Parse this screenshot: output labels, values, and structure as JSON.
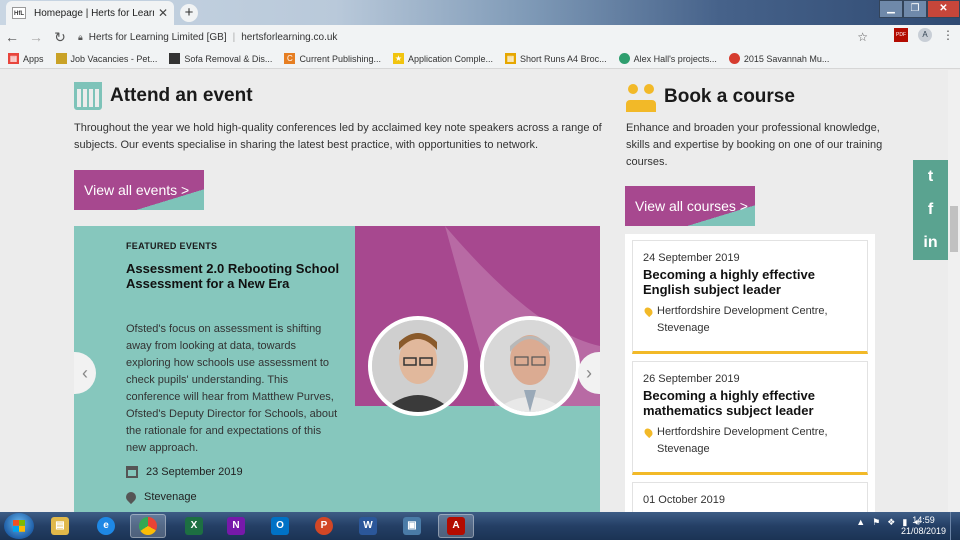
{
  "browser": {
    "tab_title": "Homepage | Herts for Learning",
    "tab_favicon_text": "HfL",
    "site_identity": "Herts for Learning Limited [GB]",
    "url": "hertsforlearning.co.uk",
    "avatar_letter": "A",
    "pdf_ext_label": "PDF",
    "bookmarks": [
      {
        "label": "Apps",
        "color": "#e8453c"
      },
      {
        "label": "Job Vacancies - Pet...",
        "color": "#c9a227"
      },
      {
        "label": "Sofa Removal & Dis...",
        "color": "#333333"
      },
      {
        "label": "Current Publishing...",
        "color": "#e67e22"
      },
      {
        "label": "Application Comple...",
        "color": "#f1c40f"
      },
      {
        "label": "Short Runs A4 Broc...",
        "color": "#e6a700"
      },
      {
        "label": "Alex Hall's projects...",
        "color": "#2e9e6e"
      },
      {
        "label": "2015 Savannah Mu...",
        "color": "#d63c2f"
      }
    ]
  },
  "events": {
    "heading": "Attend an event",
    "intro": "Throughout the year we hold high-quality conferences led by acclaimed key note speakers across a range of subjects. Our events specialise in sharing the latest best practice, with opportunities to network.",
    "cta_label": "View all events >",
    "featured": {
      "label": "FEATURED EVENTS",
      "title": "Assessment 2.0 Rebooting School Assessment for a New Era",
      "description": "Ofsted's focus on assessment is shifting away from looking at data, towards exploring how schools use assessment to check pupils' understanding. This conference will hear from Matthew Purves, Ofsted's Deputy Director for Schools, about the rationale for and expectations of this new approach.",
      "date": "23 September 2019",
      "location": "Stevenage"
    }
  },
  "courses": {
    "heading": "Book a course",
    "intro": "Enhance and broaden your professional knowledge, skills and expertise by booking on one of our training courses.",
    "cta_label": "View all courses >",
    "items": [
      {
        "date": "24 September 2019",
        "title": "Becoming a highly effective English subject leader",
        "location": "Hertfordshire Development Centre, Stevenage"
      },
      {
        "date": "26 September 2019",
        "title": "Becoming a highly effective mathematics subject leader",
        "location": "Hertfordshire Development Centre, Stevenage"
      },
      {
        "date": "01 October 2019",
        "title": "",
        "location": ""
      }
    ]
  },
  "social": {
    "twitter": "t",
    "facebook": "f",
    "linkedin": "in"
  },
  "colors": {
    "accent_purple": "#a7488f",
    "accent_teal": "#86c7bd",
    "accent_yellow": "#f2b928"
  },
  "taskbar": {
    "time": "14:59",
    "date": "21/08/2019",
    "apps": [
      {
        "name": "explorer",
        "glyph": "▤",
        "color": "#e0b84a"
      },
      {
        "name": "ie",
        "glyph": "e",
        "color": "#1e88e5"
      },
      {
        "name": "chrome",
        "glyph": "◉",
        "color": "#34a853"
      },
      {
        "name": "excel",
        "glyph": "X",
        "color": "#1d6f42"
      },
      {
        "name": "onenote",
        "glyph": "N",
        "color": "#7719aa"
      },
      {
        "name": "outlook",
        "glyph": "O",
        "color": "#0072c6"
      },
      {
        "name": "powerpoint",
        "glyph": "P",
        "color": "#d24726"
      },
      {
        "name": "word",
        "glyph": "W",
        "color": "#2b579a"
      },
      {
        "name": "photo",
        "glyph": "▣",
        "color": "#4a7ba7"
      },
      {
        "name": "acrobat",
        "glyph": "A",
        "color": "#b30b00"
      }
    ]
  }
}
